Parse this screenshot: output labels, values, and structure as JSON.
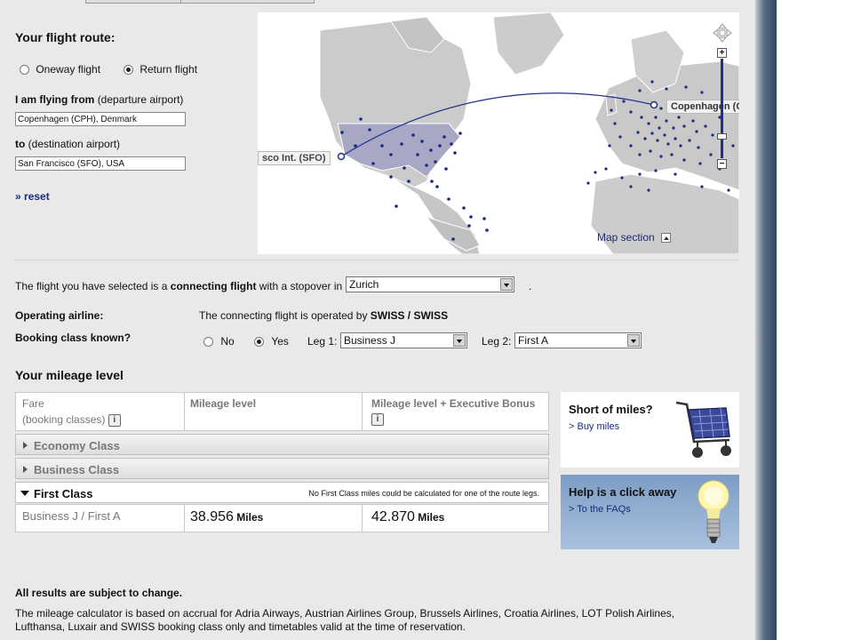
{
  "route": {
    "title": "Your flight route:",
    "oneway_label": "Oneway flight",
    "return_label": "Return flight",
    "from_label_bold": "I am flying from",
    "from_label_rest": "(departure airport)",
    "from_value": "Copenhagen (CPH), Denmark",
    "to_label_bold": "to",
    "to_label_rest": "(destination airport)",
    "to_value": "San Francisco (SFO), USA",
    "reset_label": "reset"
  },
  "map": {
    "origin_label": "Copenhagen (C",
    "dest_label": "sco Int. (SFO)",
    "map_section_label": "Map section",
    "zoom_in": "+",
    "zoom_out": "−",
    "route_color": "#1f2f8a",
    "dot_color": "#1c2a80"
  },
  "connection": {
    "text_pre": "The flight you have selected is a",
    "text_bold": "connecting flight",
    "text_post": "with a stopover in",
    "stopover_value": "Zurich",
    "trailing": ".",
    "operating_label": "Operating airline:",
    "operated_pre": "The connecting flight is operated by",
    "operated_bold": "SWISS / SWISS",
    "booking_label": "Booking class known?",
    "no_label": "No",
    "yes_label": "Yes",
    "leg1_label": "Leg 1:",
    "leg1_value": "Business J",
    "leg2_label": "Leg 2:",
    "leg2_value": "First A"
  },
  "mileage": {
    "title": "Your mileage level",
    "col_fare": "Fare",
    "col_fare_sub": "(booking classes)",
    "col_level": "Mileage level",
    "col_bonus": "Mileage level + Executive Bonus",
    "economy_label": "Economy Class",
    "business_label": "Business Class",
    "first_label": "First Class",
    "first_note": "No First Class miles could be calculated for one of the route legs.",
    "row_fare": "Business J / First A",
    "row_level_value": "38.956",
    "row_bonus_value": "42.870",
    "miles_unit": "Miles"
  },
  "promos": {
    "short_title": "Short of miles?",
    "short_link": "> Buy miles",
    "help_title": "Help is a click away",
    "help_link": "> To the FAQs"
  },
  "footer": {
    "disclaimer": "All results are subject to change.",
    "line1": "The mileage calculator is based on accrual for Adria Airways, Austrian Airlines Group, Brussels Airlines, Croatia Airlines, LOT Polish Airlines,",
    "line2": "Lufthansa, Luxair and SWISS booking class only and timetables valid at the time of reservation."
  }
}
